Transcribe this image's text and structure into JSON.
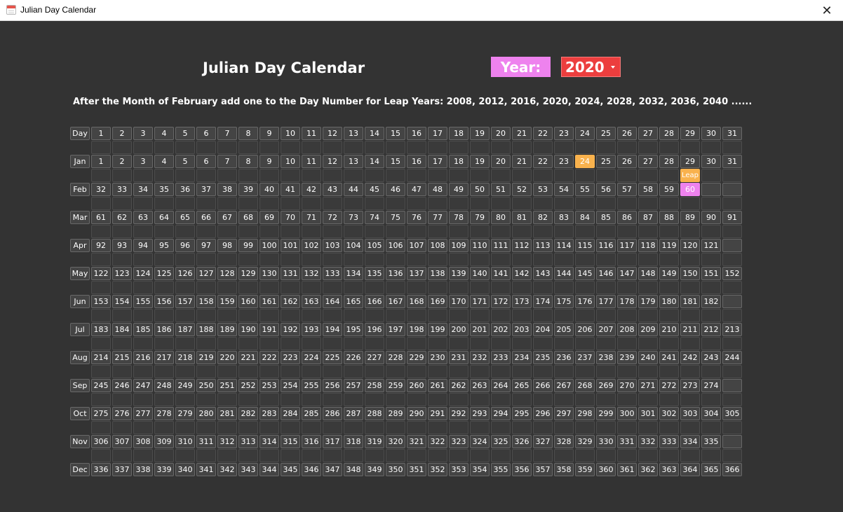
{
  "window": {
    "title": "Julian Day Calendar",
    "close_glyph": "✕",
    "icon": "calendar-icon"
  },
  "page": {
    "title": "Julian Day Calendar",
    "year_label": "Year:",
    "year_value": "2020",
    "note": "After the Month of February add one to the Day Number for Leap Years: 2008, 2012, 2016, 2020, 2024, 2028, 2032, 2036, 2040 ......"
  },
  "calendar": {
    "header_label": "Day",
    "days": [
      "1",
      "2",
      "3",
      "4",
      "5",
      "6",
      "7",
      "8",
      "9",
      "10",
      "11",
      "12",
      "13",
      "14",
      "15",
      "16",
      "17",
      "18",
      "19",
      "20",
      "21",
      "22",
      "23",
      "24",
      "25",
      "26",
      "27",
      "28",
      "29",
      "30",
      "31"
    ],
    "months": [
      {
        "name": "Jan",
        "start": 1,
        "days": 31
      },
      {
        "name": "Feb",
        "start": 32,
        "days": 29
      },
      {
        "name": "Mar",
        "start": 61,
        "days": 31
      },
      {
        "name": "Apr",
        "start": 92,
        "days": 30
      },
      {
        "name": "May",
        "start": 122,
        "days": 31
      },
      {
        "name": "Jun",
        "start": 153,
        "days": 30
      },
      {
        "name": "Jul",
        "start": 183,
        "days": 31
      },
      {
        "name": "Aug",
        "start": 214,
        "days": 31
      },
      {
        "name": "Sep",
        "start": 245,
        "days": 30
      },
      {
        "name": "Oct",
        "start": 275,
        "days": 31
      },
      {
        "name": "Nov",
        "start": 306,
        "days": 30
      },
      {
        "name": "Dec",
        "start": 336,
        "days": 31
      }
    ],
    "highlight_today": {
      "month": "Jan",
      "day": 24
    },
    "leap_day": {
      "month": "Feb",
      "day": 29
    },
    "leap_label": "Leap",
    "colors": {
      "today": "#f9b24d",
      "leap": "#ee82ee",
      "year_select": "#ec3e3e",
      "background": "#333333"
    }
  }
}
